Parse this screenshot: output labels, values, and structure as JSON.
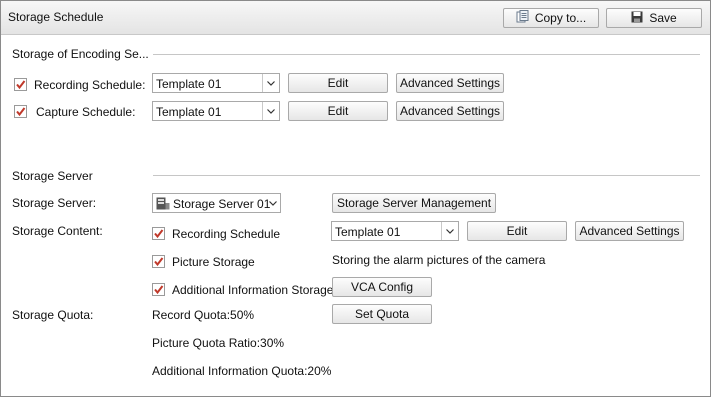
{
  "window": {
    "title": "Storage Schedule"
  },
  "toolbar": {
    "copy_label": "Copy to...",
    "save_label": "Save"
  },
  "encoding": {
    "section_title": "Storage of Encoding Se...",
    "recording": {
      "label": "Recording Schedule:",
      "checked": true,
      "template": "Template 01",
      "edit_label": "Edit",
      "advanced_label": "Advanced Settings"
    },
    "capture": {
      "label": "Capture Schedule:",
      "checked": true,
      "template": "Template 01",
      "edit_label": "Edit",
      "advanced_label": "Advanced Settings"
    }
  },
  "server": {
    "section_title": "Storage Server",
    "server_label": "Storage Server:",
    "server_value": "Storage Server 01",
    "management_label": "Storage Server Management",
    "content_label": "Storage Content:",
    "recording_schedule": {
      "label": "Recording Schedule",
      "checked": true,
      "template": "Template 01",
      "edit_label": "Edit",
      "advanced_label": "Advanced Settings"
    },
    "picture_storage": {
      "label": "Picture Storage",
      "checked": true,
      "note": "Storing the alarm pictures of the camera"
    },
    "additional_info": {
      "label": "Additional Information Storage",
      "checked": true,
      "vca_label": "VCA Config"
    },
    "quota_label": "Storage Quota:",
    "record_quota": "Record Quota:50%",
    "set_quota_label": "Set Quota",
    "picture_quota": "Picture Quota Ratio:30%",
    "additional_quota": "Additional Information Quota:20%"
  },
  "colors": {
    "check_mark": "#c0392b",
    "border": "#a9a9a9",
    "titlebar": "#ececec"
  },
  "icons": {
    "copy": "copy-icon",
    "save": "save-icon",
    "checkbox": "checkbox-checked-icon",
    "dropdown": "chevron-down-icon",
    "server": "server-icon"
  }
}
